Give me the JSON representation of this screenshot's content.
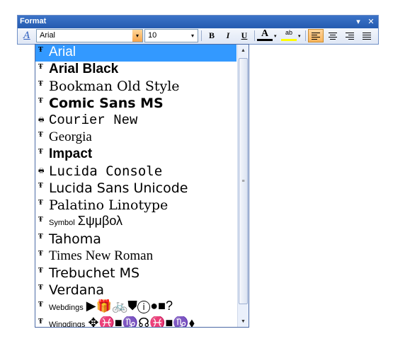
{
  "toolbar": {
    "title": "Format",
    "menu_glyph": "▾",
    "close_glyph": "✕",
    "style_icon_glyph": "A",
    "font_value": "Arial",
    "size_value": "10",
    "bold": "B",
    "italic": "I",
    "underline": "U",
    "font_color_glyph": "A",
    "highlight_glyph": "ab",
    "dropdown_arrow": "▾"
  },
  "fonts": [
    {
      "label": "Arial",
      "kind": "truetype",
      "family": "Liberation Sans, sans-serif"
    },
    {
      "label": "Arial Black",
      "kind": "truetype",
      "family": "Liberation Sans, sans-serif",
      "weight": "900"
    },
    {
      "label": "Bookman Old Style",
      "kind": "truetype",
      "family": "DejaVu Serif, serif"
    },
    {
      "label": "Comic Sans MS",
      "kind": "truetype",
      "family": "DejaVu Sans, sans-serif",
      "weight": "bold"
    },
    {
      "label": "Courier New",
      "kind": "printer",
      "family": "Liberation Mono, monospace"
    },
    {
      "label": "Georgia",
      "kind": "truetype",
      "family": "Liberation Serif, serif"
    },
    {
      "label": "Impact",
      "kind": "truetype",
      "family": "Liberation Sans, sans-serif",
      "weight": "900"
    },
    {
      "label": "Lucida Console",
      "kind": "printer",
      "family": "DejaVu Sans Mono, monospace"
    },
    {
      "label": "Lucida Sans Unicode",
      "kind": "truetype",
      "family": "DejaVu Sans, sans-serif"
    },
    {
      "label": "Palatino Linotype",
      "kind": "truetype",
      "family": "DejaVu Serif, serif"
    },
    {
      "label": "Symbol",
      "kind": "truetype",
      "family": "Liberation Sans, sans-serif",
      "sample": "Σψμβολ"
    },
    {
      "label": "Tahoma",
      "kind": "truetype",
      "family": "DejaVu Sans, sans-serif"
    },
    {
      "label": "Times New Roman",
      "kind": "truetype",
      "family": "Liberation Serif, serif"
    },
    {
      "label": "Trebuchet MS",
      "kind": "truetype",
      "family": "DejaVu Sans, sans-serif"
    },
    {
      "label": "Verdana",
      "kind": "truetype",
      "family": "DejaVu Sans, sans-serif"
    },
    {
      "label": "Webdings",
      "kind": "truetype",
      "family": "Liberation Sans, sans-serif",
      "sample": "▶🎁🚲⛊ⓘ●■?"
    },
    {
      "label": "Wingdings",
      "kind": "truetype",
      "family": "Liberation Sans, sans-serif",
      "sample": "✥♓■♑☊♓■♑⬧"
    }
  ],
  "selected_font_index": 0,
  "colors": {
    "title_bar": "#255bb0",
    "selection": "#3399ff",
    "active_button": "#f8b45c"
  }
}
